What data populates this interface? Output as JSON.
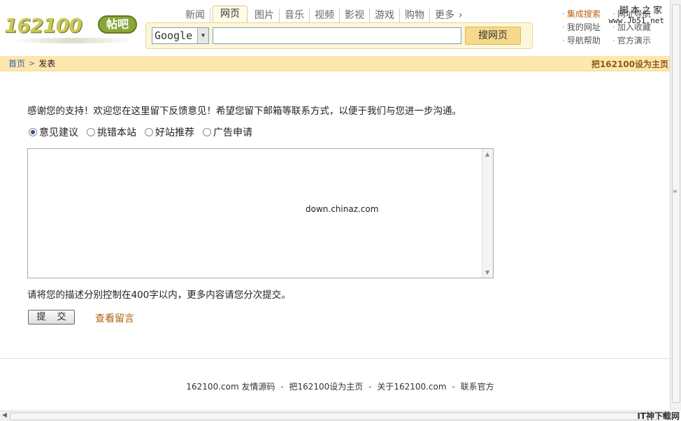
{
  "logo": {
    "number": "162100",
    "badge": "帖吧"
  },
  "nav": {
    "items": [
      {
        "label": "新闻",
        "active": false
      },
      {
        "label": "网页",
        "active": true
      },
      {
        "label": "图片",
        "active": false
      },
      {
        "label": "音乐",
        "active": false
      },
      {
        "label": "视频",
        "active": false
      },
      {
        "label": "影视",
        "active": false
      },
      {
        "label": "游戏",
        "active": false
      },
      {
        "label": "购物",
        "active": false
      }
    ],
    "more_label": "更多",
    "more_icon": "›"
  },
  "search": {
    "engine": "Google",
    "engine_arrow": "▼",
    "query": "",
    "button": "搜网页"
  },
  "quick_links": [
    {
      "label": "集成搜索",
      "highlight": true
    },
    {
      "label": "网址导航",
      "highlight": false
    },
    {
      "label": "我的网址",
      "highlight": false
    },
    {
      "label": "加入收藏",
      "highlight": false
    },
    {
      "label": "导航帮助",
      "highlight": false
    },
    {
      "label": "官方演示",
      "highlight": false
    }
  ],
  "watermark": {
    "line1": "脚本之家",
    "line2": "www.Jb51.net"
  },
  "breadcrumb": {
    "home": "首页",
    "separator": ">",
    "current": "发表",
    "set_home": "把162100设为主页"
  },
  "form": {
    "intro": "感谢您的支持！欢迎您在这里留下反馈意见！希望您留下邮箱等联系方式，以便于我们与您进一步沟通。",
    "radios": [
      {
        "label": "意见建议",
        "checked": true
      },
      {
        "label": "挑错本站",
        "checked": false
      },
      {
        "label": "好站推荐",
        "checked": false
      },
      {
        "label": "广告申请",
        "checked": false
      }
    ],
    "textarea_value": "down.chinaz.com",
    "limit_note": "请将您的描述分别控制在400字以内，更多内容请您分次提交。",
    "submit": "提 交",
    "view_messages": "查看留言"
  },
  "footer": {
    "site": "162100.com",
    "links": [
      "友情源码",
      "把162100设为主页",
      "关于162100.com",
      "联系官方"
    ],
    "separator": "-"
  },
  "corner_mark": "IT神下载网"
}
